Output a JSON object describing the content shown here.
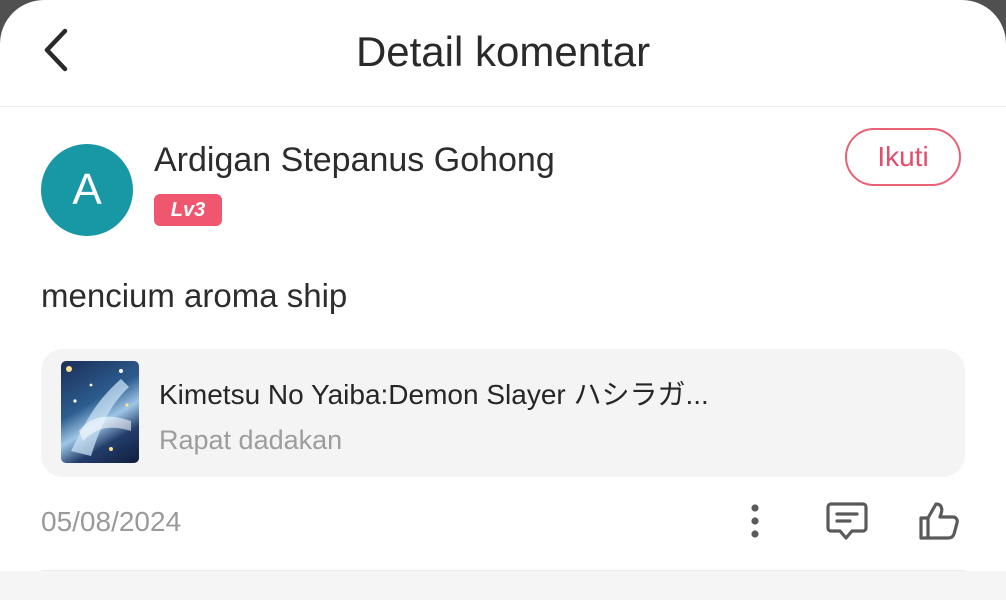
{
  "header": {
    "title": "Detail komentar"
  },
  "comment": {
    "author": {
      "initial": "A",
      "name": "Ardigan Stepanus Gohong",
      "level": "Lv3"
    },
    "follow_label": "Ikuti",
    "text": "mencium aroma ship",
    "date": "05/08/2024"
  },
  "work": {
    "title": "Kimetsu No Yaiba:Demon Slayer ハシラガ...",
    "subtitle": "Rapat dadakan"
  },
  "icons": {
    "back": "chevron-left-icon",
    "more": "more-vertical-icon",
    "reply": "comment-icon",
    "like": "thumbs-up-icon"
  },
  "colors": {
    "accent": "#e24e69",
    "badge": "#f1566f",
    "avatar": "#1897a5",
    "muted_text": "#9a9a9a",
    "card_bg": "#f4f4f4"
  }
}
